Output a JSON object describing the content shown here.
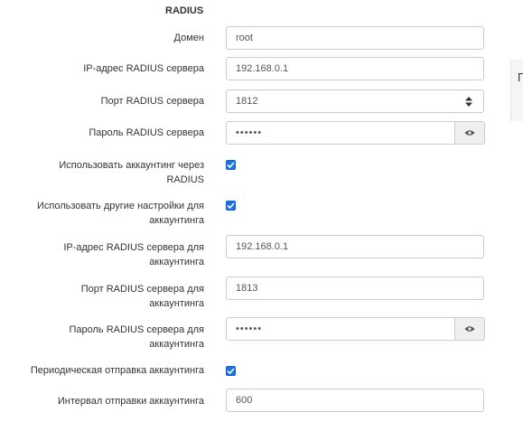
{
  "section": {
    "title": "RADIUS"
  },
  "fields": {
    "domain": {
      "label": "Домен",
      "value": "root"
    },
    "server_ip": {
      "label": "IP-адрес RADIUS сервера",
      "value": "192.168.0.1"
    },
    "server_port": {
      "label": "Порт RADIUS сервера",
      "value": "1812"
    },
    "server_password": {
      "label": "Пароль RADIUS сервера",
      "value": "••••••"
    },
    "use_accounting": {
      "label_line1": "Использовать аккаунтинг через",
      "label_line2": "RADIUS",
      "checked": true
    },
    "other_accounting_settings": {
      "label_line1": "Использовать другие настройки для",
      "label_line2": "аккаунтинга",
      "checked": true
    },
    "acct_ip": {
      "label_line1": "IP-адрес RADIUS сервера для",
      "label_line2": "аккаунтинга",
      "value": "192.168.0.1"
    },
    "acct_port": {
      "label_line1": "Порт RADIUS сервера для",
      "label_line2": "аккаунтинга",
      "value": "1813"
    },
    "acct_password": {
      "label_line1": "Пароль RADIUS сервера для",
      "label_line2": "аккаунтинга",
      "value": "••••••"
    },
    "periodic_accounting": {
      "label": "Периодическая отправка аккаунтинга",
      "checked": true
    },
    "accounting_interval": {
      "label": "Интервал отправки аккаунтинга",
      "value": "600"
    }
  },
  "side_panel": {
    "fragment_char": "П"
  },
  "colors": {
    "checkbox": "#1a73e8",
    "border": "#cccccc",
    "addon_bg": "#efefef"
  },
  "icons": {
    "password_toggle": "eye-icon",
    "number_spinner": "spinner-icon",
    "checkmark": "check-icon"
  }
}
